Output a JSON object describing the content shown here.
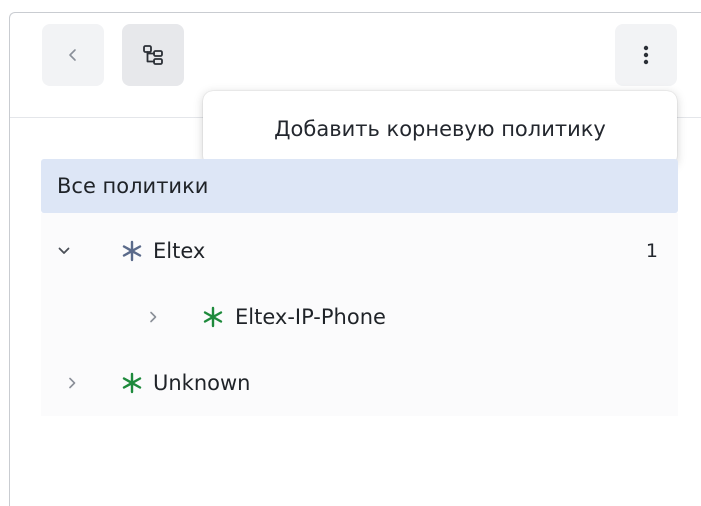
{
  "toolbar": {
    "back_icon": "chevron-left-icon",
    "tree_icon": "tree-structure-icon",
    "more_icon": "vertical-dots-icon"
  },
  "tooltip": {
    "text": "Добавить корневую политику"
  },
  "policies": {
    "all_label": "Все политики",
    "tree": [
      {
        "label": "Eltex",
        "count": "1",
        "expanded": true,
        "icon": "asterisk-node-icon",
        "icon_color": "#5a6a8a",
        "children": [
          {
            "label": "Eltex-IP-Phone",
            "expanded": false,
            "icon": "asterisk-node-icon",
            "icon_color": "#1e8a3c"
          }
        ]
      },
      {
        "label": "Unknown",
        "expanded": false,
        "icon": "asterisk-node-icon",
        "icon_color": "#1e8a3c"
      }
    ]
  },
  "colors": {
    "selected_row_bg": "#dde6f6",
    "group_icon": "#5a6a8a",
    "leaf_icon": "#1e8a3c"
  }
}
